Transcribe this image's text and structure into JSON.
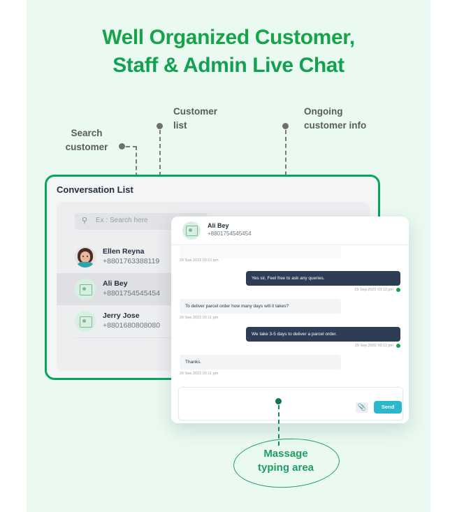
{
  "header": {
    "title_line1": "Well Organized Customer,",
    "title_line2": "Staff & Admin Live Chat",
    "title_color": "#16a34a"
  },
  "annotations": {
    "search": "Search\ncustomer",
    "search_line1": "Search",
    "search_line2": "customer",
    "list_line1": "Customer",
    "list_line2": "list",
    "info_line1": "Ongoing",
    "info_line2": "customer info",
    "typing_line1": "Massage",
    "typing_line2": "typing area",
    "callout_color": "#1f9d62",
    "line_color": "#7a7a7a"
  },
  "conversation_panel": {
    "title": "Conversation List",
    "border_color": "#06a75b",
    "search": {
      "placeholder": "Ex : Search here",
      "icon": "search-icon"
    },
    "contacts": [
      {
        "name": "Ellen Reyna",
        "phone": "+8801763388119",
        "avatar": "photo-avatar",
        "selected": false
      },
      {
        "name": "Ali Bey",
        "phone": "+8801754545454",
        "avatar": "contact-card-icon",
        "selected": true
      },
      {
        "name": "Jerry Jose",
        "phone": "+8801680808080",
        "avatar": "contact-card-icon",
        "selected": false
      }
    ]
  },
  "chat_panel": {
    "contact_name": "Ali Bey",
    "contact_phone": "+8801754545454",
    "avatar": "contact-card-icon",
    "messages": [
      {
        "direction": "in",
        "text": "",
        "timestamp": "29 Sep 2022 03:01 pm",
        "clipped": true
      },
      {
        "direction": "out",
        "text": "Yes sir, Feel free to ask any queries.",
        "timestamp": "29 Sep 2022 03:13 pm",
        "read": true
      },
      {
        "direction": "in",
        "text": "To deliver parcel order how many days will it takes?",
        "timestamp": "29 Sep 2022 03:11 pm"
      },
      {
        "direction": "out",
        "text": "We take 3-5 days to deliver a parcel order.",
        "timestamp": "29 Sep 2022 03:11 pm",
        "read": true
      },
      {
        "direction": "in",
        "text": "Thanks.",
        "timestamp": "29 Sep 2022 03:11 pm"
      }
    ],
    "composer": {
      "placeholder": "",
      "attach_icon": "paperclip-icon",
      "send_label": "Send",
      "send_color": "#2bb7cc"
    },
    "outgoing_bubble_color": "#2e3c56",
    "incoming_bubble_color": "#f3f4f6"
  }
}
